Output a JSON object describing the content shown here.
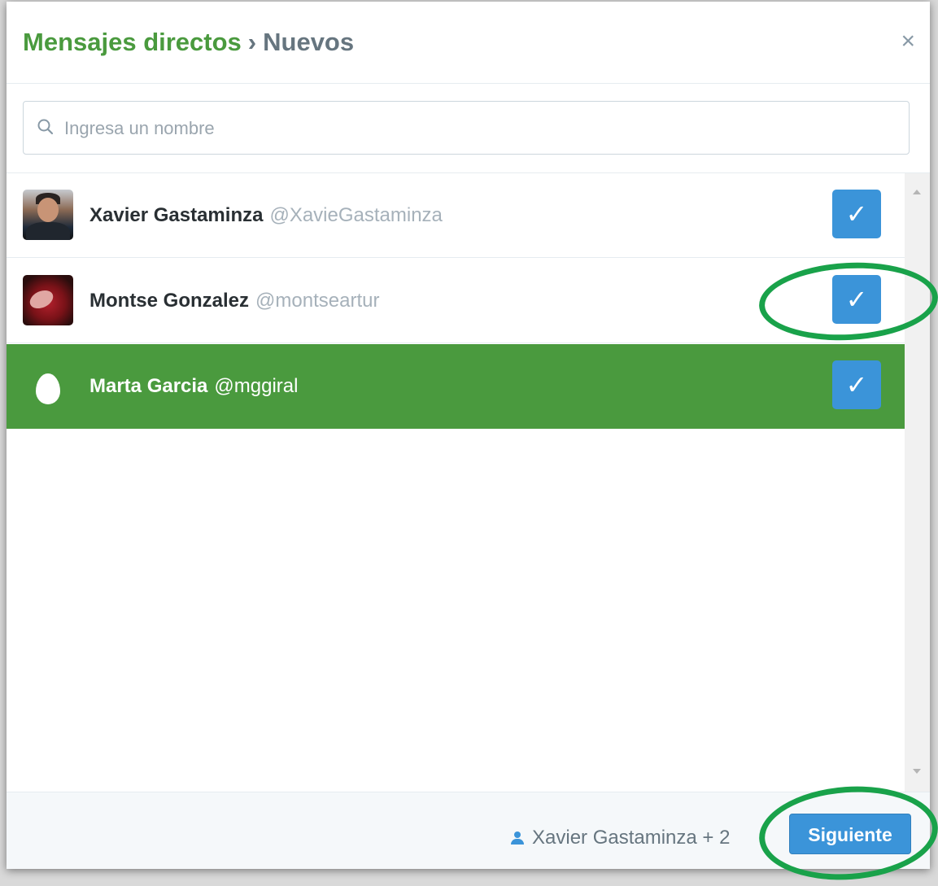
{
  "dialog": {
    "title_link": "Mensajes directos",
    "title_separator": "›",
    "title_current": "Nuevos",
    "close_label": "×"
  },
  "search": {
    "placeholder": "Ingresa un nombre",
    "value": "",
    "icon": "search-icon"
  },
  "contacts": [
    {
      "name": "Xavier Gastaminza",
      "handle": "@XavieGastaminza",
      "checked": true,
      "highlighted": false,
      "avatar": "photo"
    },
    {
      "name": "Montse Gonzalez",
      "handle": "@montseartur",
      "checked": true,
      "highlighted": false,
      "avatar": "photo"
    },
    {
      "name": "Marta Garcia",
      "handle": "@mggiral",
      "checked": true,
      "highlighted": true,
      "avatar": "egg"
    }
  ],
  "check_glyph": "✓",
  "footer": {
    "recipients": "Xavier Gastaminza + 2",
    "next_label": "Siguiente"
  },
  "colors": {
    "accent_blue": "#3b94d9",
    "highlight_green": "#4a9a3e",
    "annotation_green": "#19a24a"
  }
}
